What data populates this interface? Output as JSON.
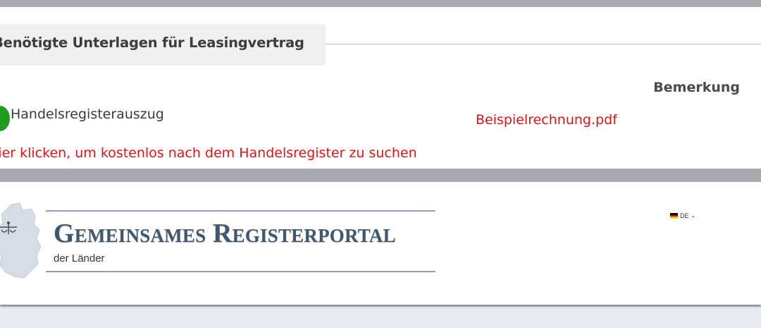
{
  "documents_section": {
    "title": "Benötigte Unterlagen für Leasingvertrag",
    "remark_header": "Bemerkung",
    "document": {
      "name": "Handelsregisterauszug",
      "status_icon": "check-circle-icon",
      "status_color": "#1f9c1f",
      "example_link": "Beispielrechnung.pdf"
    },
    "search_hint": "Hier klicken, um kostenlos nach dem Handelsregister zu suchen",
    "link_color": "#e01414"
  },
  "portal_header": {
    "title": "Gemeinsames Registerportal",
    "subtitle": "der Länder",
    "logo_icon": "germany-map-scales-icon",
    "language": {
      "selected": "DE",
      "flag_icon": "german-flag-icon",
      "flag_colors": [
        "#000000",
        "#dd0000",
        "#ffce00"
      ],
      "chevron": "chevron-down-icon"
    },
    "accent_color": "#3f5870"
  }
}
